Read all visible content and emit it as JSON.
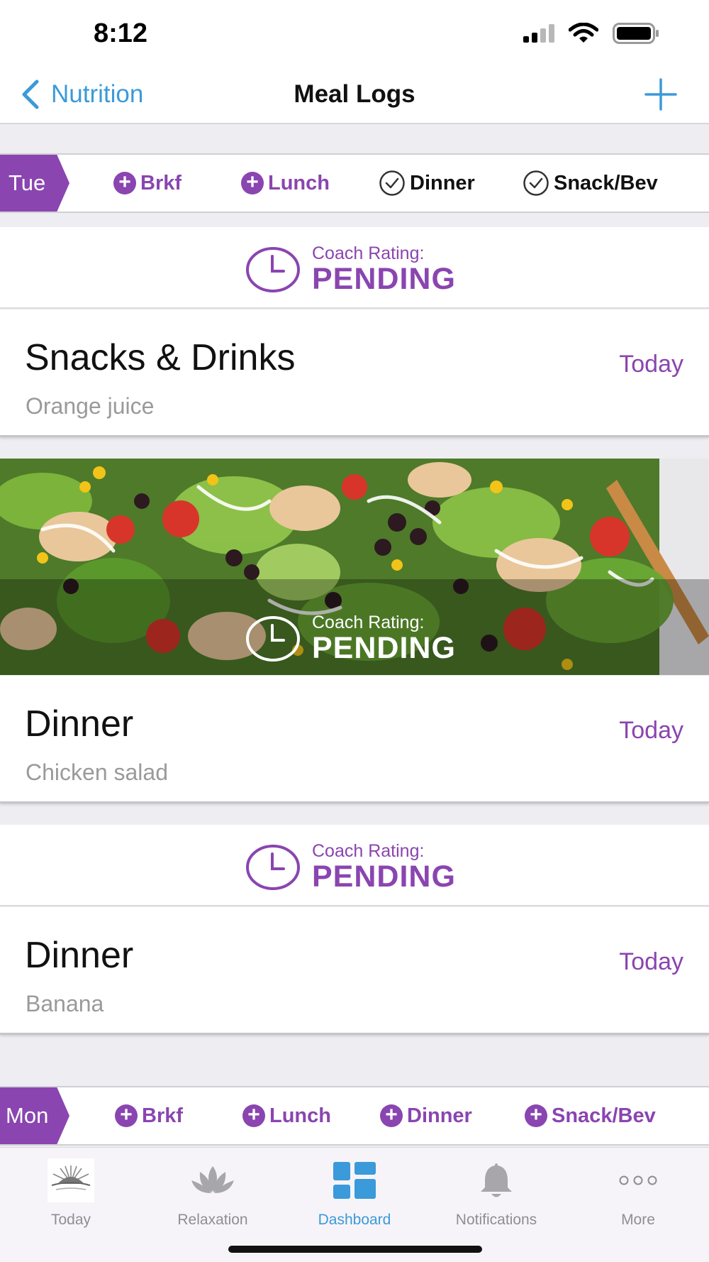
{
  "status_bar": {
    "time": "8:12"
  },
  "nav": {
    "back_label": "Nutrition",
    "title": "Meal Logs"
  },
  "days": [
    {
      "day": "Tue",
      "meals": [
        {
          "label": "Brkf",
          "state": "add"
        },
        {
          "label": "Lunch",
          "state": "add"
        },
        {
          "label": "Dinner",
          "state": "done"
        },
        {
          "label": "Snack/Bev",
          "state": "done"
        }
      ]
    },
    {
      "day": "Mon",
      "meals": [
        {
          "label": "Brkf",
          "state": "add"
        },
        {
          "label": "Lunch",
          "state": "add"
        },
        {
          "label": "Dinner",
          "state": "add"
        },
        {
          "label": "Snack/Bev",
          "state": "add"
        }
      ]
    }
  ],
  "logs": [
    {
      "rating_label": "Coach Rating:",
      "rating_value": "PENDING",
      "title": "Snacks & Drinks",
      "date": "Today",
      "description": "Orange juice",
      "has_photo": false
    },
    {
      "rating_label": "Coach Rating:",
      "rating_value": "PENDING",
      "title": "Dinner",
      "date": "Today",
      "description": "Chicken salad",
      "has_photo": true
    },
    {
      "rating_label": "Coach Rating:",
      "rating_value": "PENDING",
      "title": "Dinner",
      "date": "Today",
      "description": "Banana",
      "has_photo": false
    }
  ],
  "tabs": [
    {
      "label": "Today",
      "icon": "sunrise-icon",
      "active": false
    },
    {
      "label": "Relaxation",
      "icon": "lotus-icon",
      "active": false
    },
    {
      "label": "Dashboard",
      "icon": "dashboard-grid-icon",
      "active": true
    },
    {
      "label": "Notifications",
      "icon": "bell-icon",
      "active": false
    },
    {
      "label": "More",
      "icon": "more-dots-icon",
      "active": false
    }
  ],
  "colors": {
    "accent_purple": "#8a45b0",
    "ios_blue": "#3b9ad9"
  }
}
